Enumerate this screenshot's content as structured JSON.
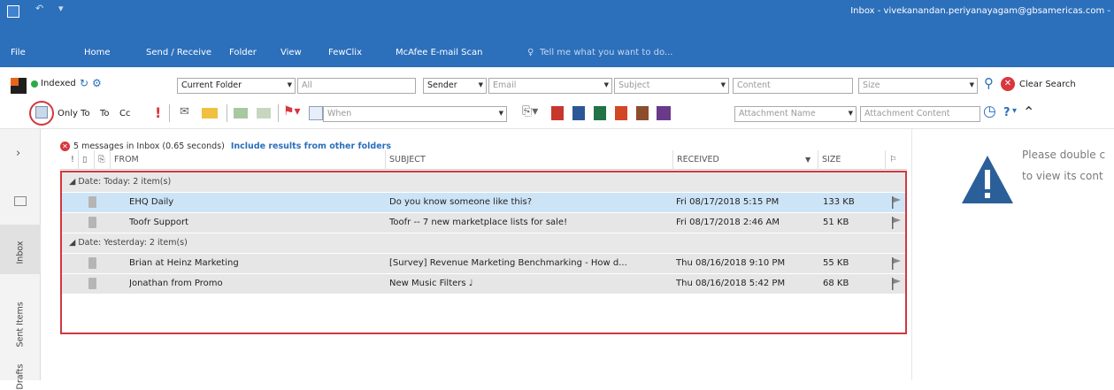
{
  "title_bar": {
    "window_title": "Inbox - vivekanandan.periyanayagam@gbsamericas.com -"
  },
  "menu": {
    "items": [
      "File",
      "Home",
      "Send / Receive",
      "Folder",
      "View",
      "FewClix",
      "McAfee E-mail Scan"
    ],
    "tell_me": "Tell me what you want to do..."
  },
  "search_bar": {
    "indexed_label": "Indexed",
    "scope": "Current Folder",
    "all_field": "All",
    "sender_dropdown": "Sender",
    "email_placeholder": "Email",
    "subject_placeholder": "Subject",
    "content_placeholder": "Content",
    "size_placeholder": "Size",
    "clear_search": "Clear Search"
  },
  "filter_bar": {
    "only_to": "Only To",
    "to": "To",
    "cc": "Cc",
    "exclaim": "!",
    "when_placeholder": "When",
    "attachment_name": "Attachment Name",
    "attachment_content": "Attachment Content",
    "question": "?"
  },
  "nav_pane": {
    "expand_icon": "chevron-right-icon",
    "items": [
      "Inbox",
      "Sent Items",
      "Drafts"
    ]
  },
  "info": {
    "message": "5 messages in Inbox (0.65 seconds)",
    "link": "Include results from other folders"
  },
  "grid": {
    "columns": [
      "!",
      "FROM",
      "SUBJECT",
      "RECEIVED",
      "SIZE"
    ],
    "groups": [
      {
        "label": "Date: Today: 2 item(s)",
        "rows": [
          {
            "from": "EHQ Daily",
            "subject": "Do you know someone like this?",
            "received": "Fri 08/17/2018 5:15 PM",
            "size": "133 KB",
            "selected": true
          },
          {
            "from": "Toofr Support",
            "subject": "Toofr -- 7 new marketplace lists for sale!",
            "received": "Fri 08/17/2018 2:46 AM",
            "size": "51 KB",
            "selected": false
          }
        ]
      },
      {
        "label": "Date: Yesterday: 2 item(s)",
        "rows": [
          {
            "from": "Brian at Heinz Marketing",
            "subject": "[Survey] Revenue Marketing Benchmarking - How d...",
            "received": "Thu 08/16/2018 9:10 PM",
            "size": "55 KB",
            "selected": false
          },
          {
            "from": "Jonathan from Promo",
            "subject": "New Music Filters ♩",
            "received": "Thu 08/16/2018 5:42 PM",
            "size": "68 KB",
            "selected": false
          }
        ]
      }
    ]
  },
  "reading_pane": {
    "line1": "Please double c",
    "line2": "to view its cont"
  },
  "colors": {
    "accent": "#2c6fbb",
    "highlight_border": "#d0383f",
    "selected_row": "#cde4f7"
  }
}
